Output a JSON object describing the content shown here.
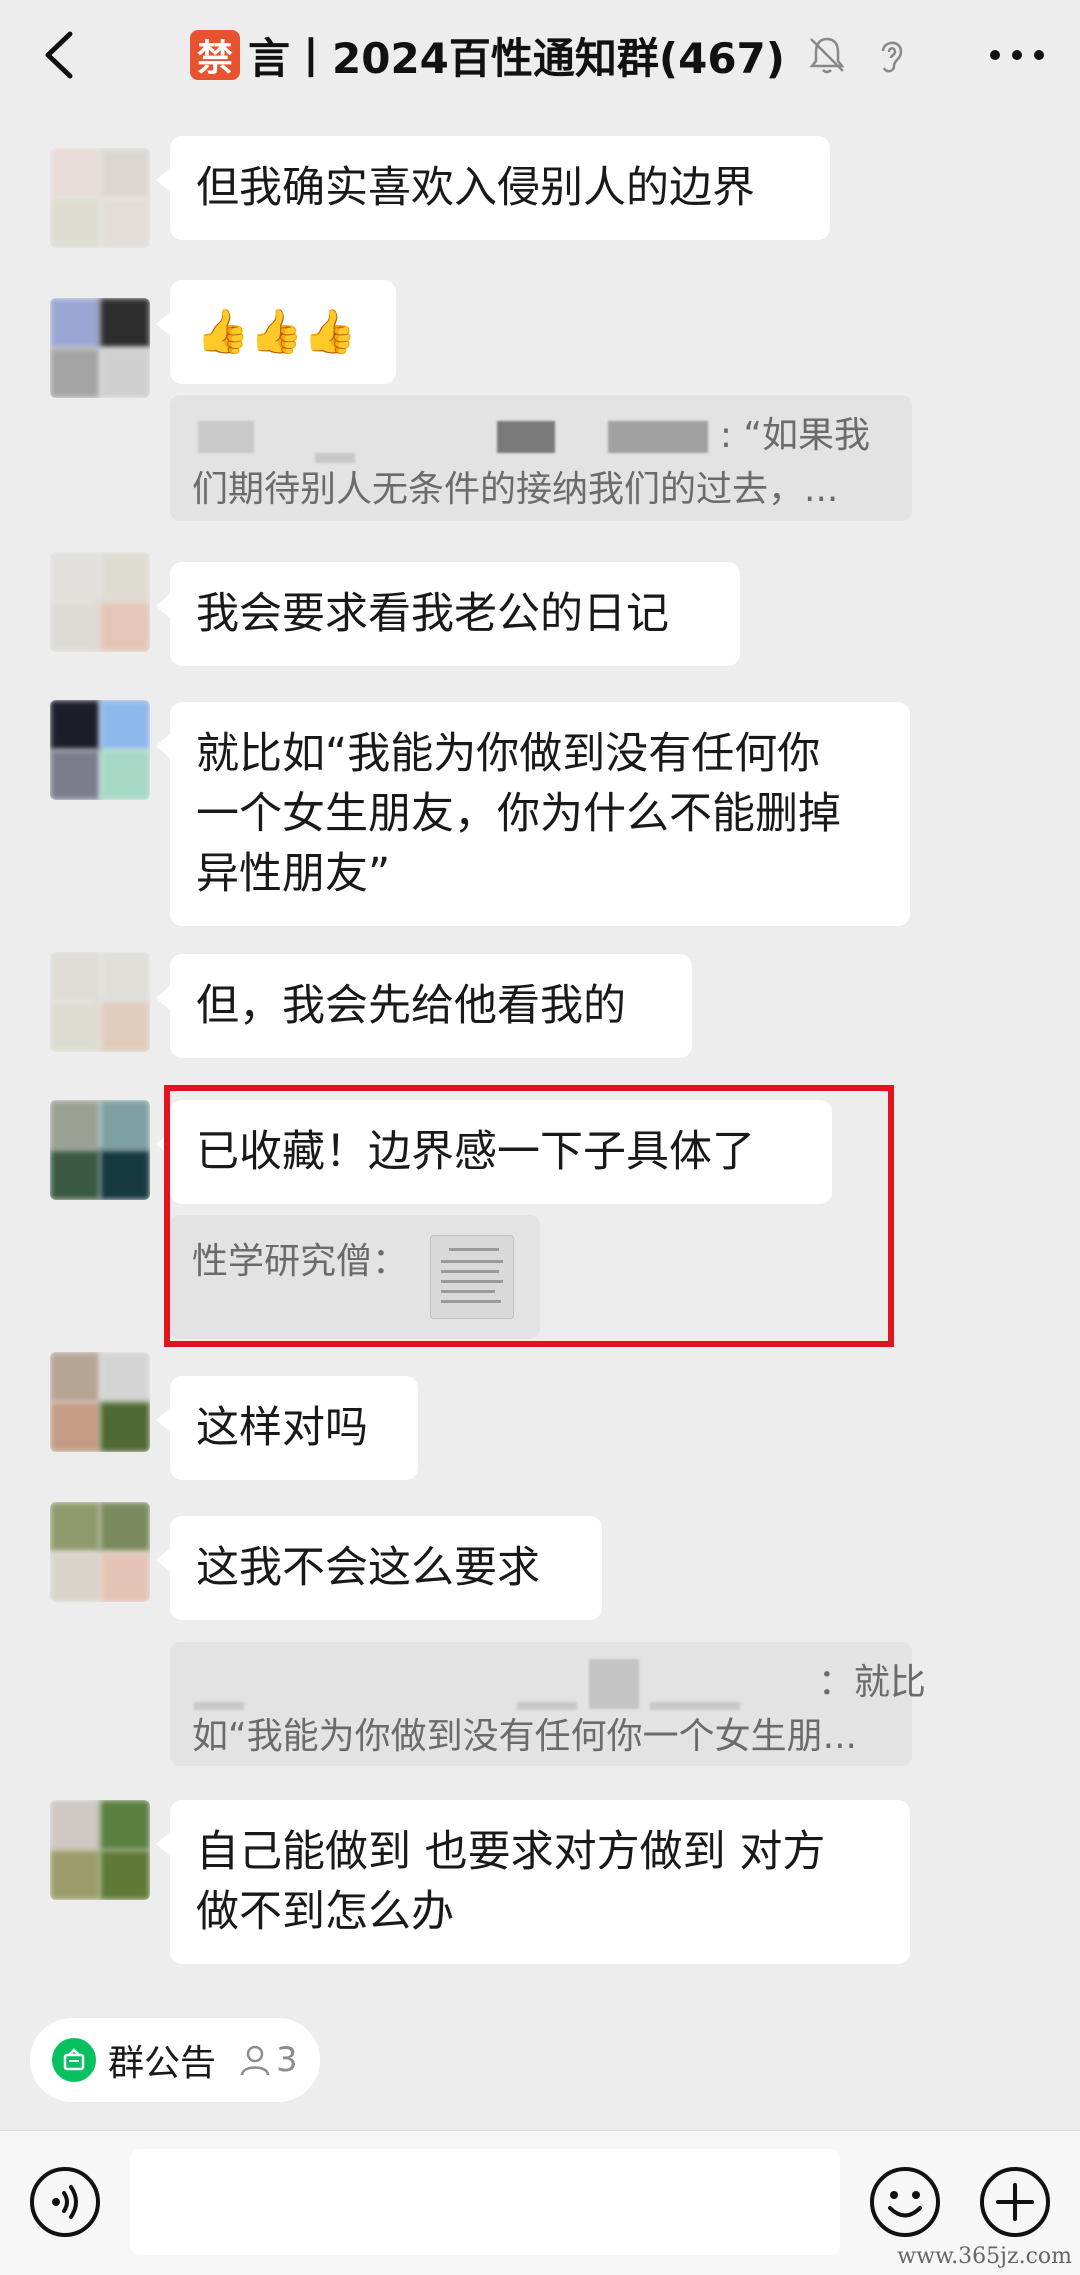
{
  "header": {
    "ban_char": "禁",
    "title": "言丨2024百性通知群(467)"
  },
  "messages": [
    {
      "text": "但我确实喜欢入侵别人的边界"
    },
    {
      "text": "👍👍👍"
    },
    {
      "quote_line1_tail": ": “如果我",
      "quote_line2": "们期待别人无条件的接纳我们的过去，..."
    },
    {
      "text": "我会要求看我老公的日记"
    },
    {
      "lines": [
        "就比如“我能为你做到没有任何你",
        "一个女生朋友，你为什么不能删掉",
        "异性朋友”"
      ]
    },
    {
      "text": "但，我会先给他看我的"
    },
    {
      "text": "已收藏！边界感一下子具体了",
      "quote_sender": "性学研究僧："
    },
    {
      "text": "这样对吗"
    },
    {
      "text": "这我不会这么要求"
    },
    {
      "quote_line1_tail": "：就比",
      "quote_line2": "如“我能为你做到没有任何你一个女生朋..."
    },
    {
      "lines": [
        "自己能做到 也要求对方做到 对方",
        "做不到怎么办"
      ]
    }
  ],
  "bottom": {
    "announcement_label": "群公告",
    "announcement_count": "3"
  },
  "watermark": "www.365jz.com",
  "colors": {
    "accent_green": "#07c160",
    "highlight_red": "#e3131e",
    "ban_badge": "#e8532f"
  },
  "icons": [
    "back-icon",
    "mute-bell-icon",
    "ear-icon",
    "more-icon",
    "voice-icon",
    "emoji-icon",
    "plus-icon",
    "announcement-icon",
    "person-icon"
  ]
}
